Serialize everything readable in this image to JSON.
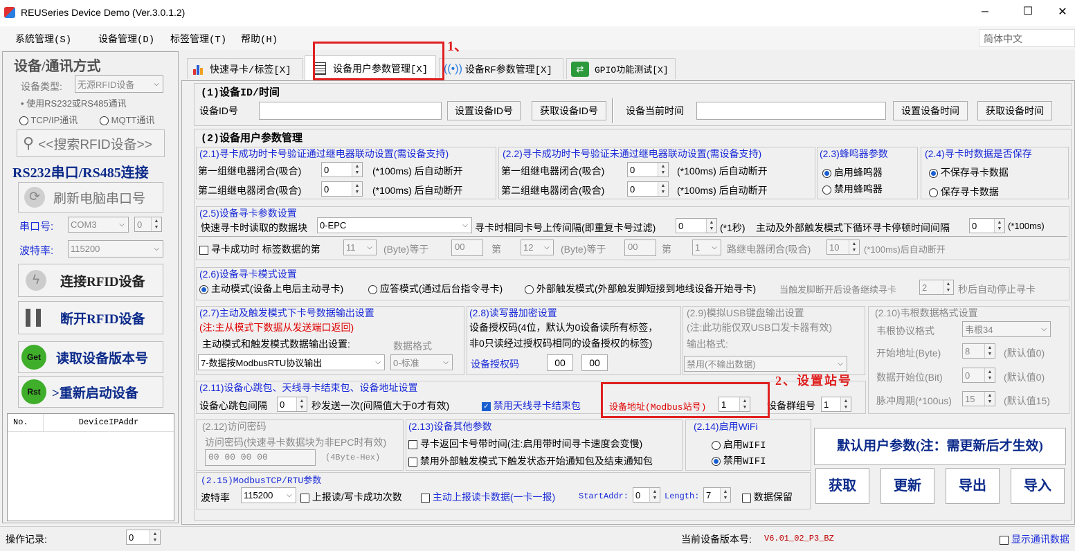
{
  "window": {
    "title": "REUSeries Device Demo (Ver.3.0.1.2)",
    "minimize": "─",
    "maximize": "☐",
    "close": "✕"
  },
  "menu": [
    "系統管理(S)",
    "设备管理(D)",
    "标签管理(T)",
    "帮助(H)"
  ],
  "language": "简体中文",
  "left": {
    "title": "设备/通讯方式",
    "device_type_label": "设备类型:",
    "device_type_value": "无源RFID设备",
    "mode_rs": "使用RS232或RS485通讯",
    "mode_tcp": "TCP/IP通讯",
    "mode_mqtt": "MQTT通讯",
    "search_btn": "<<搜索RFID设备>>",
    "rs_title": "RS232串口/RS485连接",
    "refresh_btn": "刷新电脑串口号",
    "port_label": "串口号:",
    "port_value": "COM3",
    "port_spin": "0",
    "baud_label": "波特率:",
    "baud_value": "115200",
    "connect_btn": "连接RFID设备",
    "disconnect_btn": "断开RFID设备",
    "version_btn": "读取设备版本号",
    "restart_btn": ">重新启动设备",
    "get_icon": "Get",
    "rst_icon": "Rst",
    "table_cols": [
      "No.",
      "DeviceIPAddr"
    ]
  },
  "tabs": [
    "快速寻卡/标签[X]",
    "设备用户参数管理[X]",
    "设备RF参数管理[X]",
    "GPIO功能测试[X]"
  ],
  "annot1": "1、",
  "annot2": "2、设置站号",
  "s1": {
    "title": "(1)设备ID/时间",
    "id_label": "设备ID号",
    "set_id": "设置设备ID号",
    "get_id": "获取设备ID号",
    "time_label": "设备当前时间",
    "set_time": "设置设备时间",
    "get_time": "获取设备时间"
  },
  "s2": {
    "title": "(2)设备用户参数管理",
    "g21": "(2.1)寻卡成功时卡号验证通过继电器联动设置(需设备支持)",
    "g22": "(2.2)寻卡成功时卡号验证未通过继电器联动设置(需设备支持)",
    "relay1": "第一组继电器闭合(吸合)",
    "relay2": "第二组继电器闭合(吸合)",
    "relay_suffix": "(*100ms) 后自动断开",
    "zero": "0",
    "g23": "(2.3)蜂鸣器参数",
    "beep_on": "启用蜂鸣器",
    "beep_off": "禁用蜂鸣器",
    "g24": "(2.4)寻卡时数据是否保存",
    "nosave": "不保存寻卡数据",
    "save": "保存寻卡数据"
  },
  "s25": {
    "title": "(2.5)设备寻卡参数设置",
    "block_label": "快速寻卡时读取的数据块",
    "block_value": "0-EPC",
    "interval_label": "寻卡时相同卡号上传间隔(即重复卡号过滤)",
    "interval_value": "0",
    "interval_unit": "(*1秒)",
    "pause_label": "主动及外部触发模式下循环寻卡停顿时间间隔",
    "pause_value": "0",
    "pause_unit": "(*100ms)",
    "cb_label": "寻卡成功时 标签数据的第",
    "b1": "11",
    "byte_eq": "(Byte)等于",
    "v1": "00",
    "di": "第",
    "b2": "12",
    "v2": "00",
    "b3": "1",
    "relay_close": "路继电器闭合(吸合)",
    "relay_ms": "10",
    "relay_tail": "(*100ms)后自动断开"
  },
  "s26": {
    "title": "(2.6)设备寻卡模式设置",
    "active": "主动模式(设备上电后主动寻卡)",
    "answer": "应答模式(通过后台指令寻卡)",
    "trigger": "外部触发模式(外部触发脚短接到地线设备开始寻卡)",
    "after": "当触发脚断开后设备继续寻卡",
    "after_value": "2",
    "after_tail": "秒后自动停止寻卡"
  },
  "s27": {
    "title": "(2.7)主动及触发模式下卡号数据输出设置",
    "note": "(注:主从模式下数据从发送端口返回)",
    "label": "主动模式和触发模式数据输出设置:",
    "fmt_label": "数据格式",
    "value": "7-数据按ModbusRTU协议输出",
    "fmt_value": "0-标准"
  },
  "s28": {
    "title": "(2.8)读写器加密设置",
    "desc1": "设备授权码(4位，默认为0设备读所有标签，",
    "desc2": "非0只读经过授权码相同的设备授权的标签)",
    "code_label": "设备授权码",
    "c1": "00",
    "c2": "00"
  },
  "s29": {
    "title": "(2.9)模拟USB键盘输出设置",
    "note": "(注:此功能仅双USB口发卡器有效)",
    "fmt": "输出格式:",
    "value": "禁用(不输出数据)"
  },
  "s210": {
    "title": "(2.10)韦根数据格式设置",
    "proto_label": "韦根协议格式",
    "proto_value": "韦根34",
    "start_label": "开始地址(Byte)",
    "start_value": "8",
    "default0": "(默认值0)",
    "bit_label": "数据开始位(Bit)",
    "bit_value": "0",
    "pulse_label": "脉冲周期(*100us)",
    "pulse_value": "15",
    "default15": "(默认值15)"
  },
  "s211": {
    "title": "(2.11)设备心跳包、天线寻卡结束包、设备地址设置",
    "hb_label": "设备心跳包间隔",
    "hb_value": "0",
    "hb_tail": "秒发送一次(间隔值大于0才有效)",
    "ant_end": "禁用天线寻卡结束包",
    "addr_label": "设备地址(Modbus站号)",
    "addr_value": "1",
    "grp_label": "设备群组号",
    "grp_value": "1"
  },
  "s212": {
    "title": "(2.12)访问密码",
    "label": "访问密码(快速寻卡数据块为非EPC时有效)",
    "value": "00 00 00 00",
    "hint": "(4Byte-Hex)"
  },
  "s213": {
    "title": "(2.13)设备其他参数",
    "cb1": "寻卡返回卡号带时间(注:启用带时间寻卡速度会变慢)",
    "cb2": "禁用外部触发模式下触发状态开始通知包及结束通知包"
  },
  "s214": {
    "title": "(2.14)启用WiFi",
    "on": "启用WIFI",
    "off": "禁用WIFI"
  },
  "s215": {
    "title": "(2.15)ModbusTCP/RTU参数",
    "baud_label": "波特率",
    "baud_value": "115200",
    "cb1": "上报读/写卡成功次数",
    "cb2": "主动上报读卡数据(一卡一报)",
    "start_label": "StartAddr:",
    "start_value": "0",
    "len_label": "Length:",
    "len_value": "7",
    "keep": "数据保留"
  },
  "actions": {
    "default": "默认用户参数(注：需更新后才生效)",
    "get": "获取",
    "update": "更新",
    "export": "导出",
    "import": "导入"
  },
  "status": {
    "log_label": "操作记录:",
    "log_value": "0",
    "ver_label": "当前设备版本号:",
    "ver_value": "V6.01_02_P3_BZ",
    "show_comm": "显示通讯数据"
  }
}
